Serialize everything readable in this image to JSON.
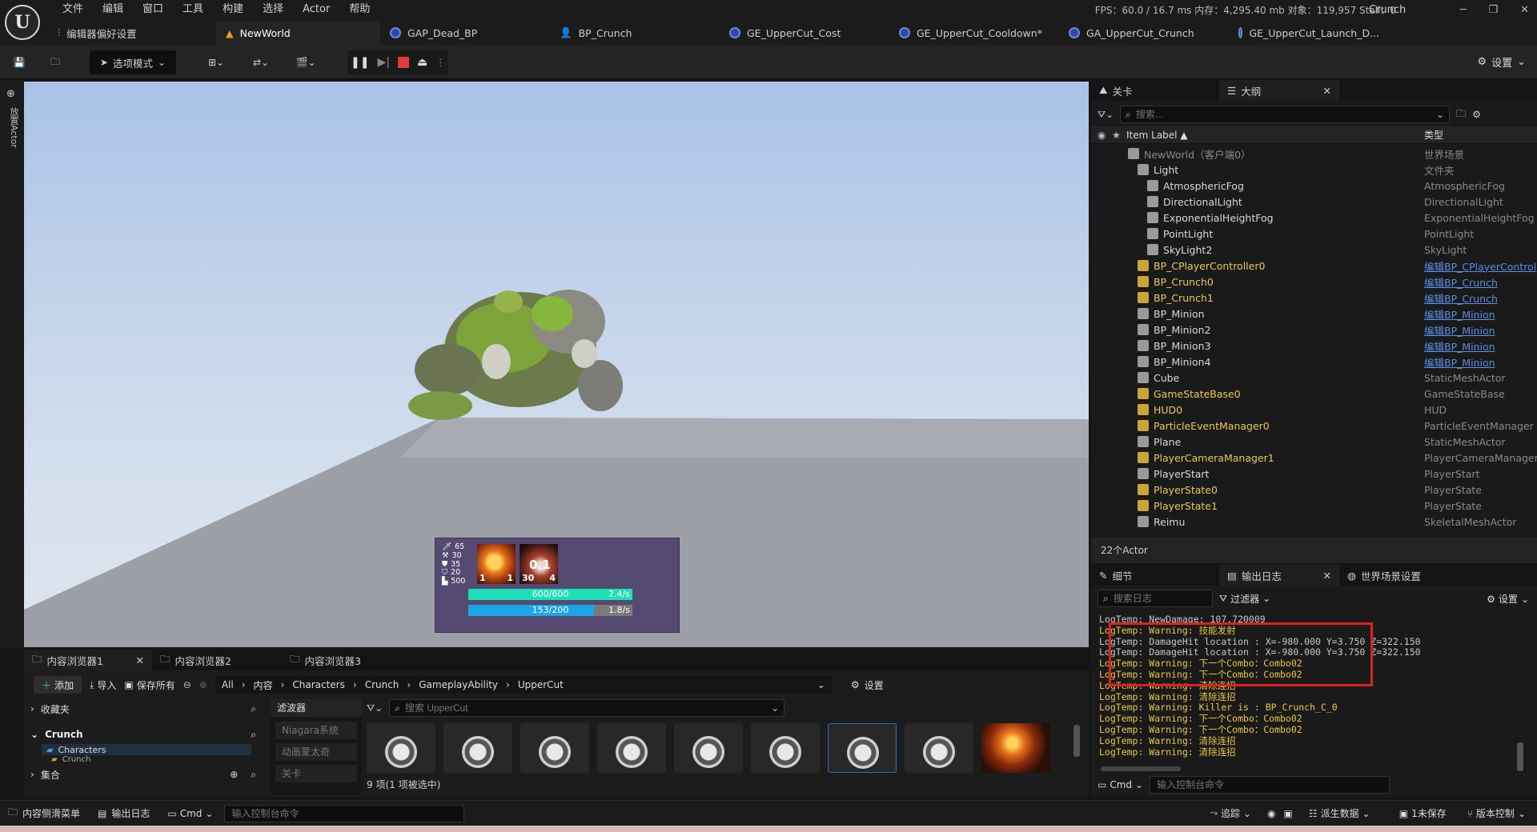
{
  "menu": [
    "文件",
    "编辑",
    "窗口",
    "工具",
    "构建",
    "选择",
    "Actor",
    "帮助"
  ],
  "stats": "FPS：60.0 / 16.7 ms  内存：4,295.40 mb  对象：119,957  Stall：0",
  "project_name": "Crunch",
  "tabs": [
    {
      "label": "编辑器偏好设置"
    },
    {
      "label": "NewWorld"
    },
    {
      "label": "GAP_Dead_BP"
    },
    {
      "label": "BP_Crunch"
    },
    {
      "label": "GE_UpperCut_Cost"
    },
    {
      "label": "GE_UpperCut_Cooldown*"
    },
    {
      "label": "GA_UpperCut_Crunch"
    },
    {
      "label": "GE_UpperCut_Launch_D..."
    }
  ],
  "toolbar": {
    "mode_label": "选项模式",
    "settings_label": "设置"
  },
  "left_strip_label": "放置Actor",
  "hud": {
    "stats": [
      "65",
      "30",
      "35",
      "20",
      "500"
    ],
    "skill1": {
      "left": "1",
      "right": "1"
    },
    "skill2": {
      "cooldown": "0.1",
      "left": "30",
      "right": "4"
    },
    "health": {
      "text": "600/600",
      "rate": "2.4/s",
      "fraction": 1.0
    },
    "mana": {
      "text": "153/200",
      "rate": "1.8/s",
      "fraction": 0.765
    }
  },
  "outliner": {
    "tab_level": "关卡",
    "tab_outline": "大纲",
    "search_placeholder": "搜索...",
    "col_label": "Item Label ▲",
    "col_type": "类型",
    "rows": [
      {
        "label": "NewWorld（客户端0）",
        "type": "世界场景",
        "indent": 3,
        "dim": true,
        "link": false
      },
      {
        "label": "Light",
        "type": "文件夹",
        "indent": 4,
        "dim": false,
        "link": false
      },
      {
        "label": "AtmosphericFog",
        "type": "AtmosphericFog",
        "indent": 5,
        "dim": false,
        "link": false
      },
      {
        "label": "DirectionalLight",
        "type": "DirectionalLight",
        "indent": 5,
        "dim": false,
        "link": false
      },
      {
        "label": "ExponentialHeightFog",
        "type": "ExponentialHeightFog",
        "indent": 5,
        "dim": false,
        "link": false
      },
      {
        "label": "PointLight",
        "type": "PointLight",
        "indent": 5,
        "dim": false,
        "link": false
      },
      {
        "label": "SkyLight2",
        "type": "SkyLight",
        "indent": 5,
        "dim": false,
        "link": false
      },
      {
        "label": "BP_CPlayerController0",
        "type": "编辑BP_CPlayerControl",
        "indent": 4,
        "dim": false,
        "link": true,
        "yellow": true
      },
      {
        "label": "BP_Crunch0",
        "type": "编辑BP_Crunch",
        "indent": 4,
        "dim": false,
        "link": true,
        "yellow": true
      },
      {
        "label": "BP_Crunch1",
        "type": "编辑BP_Crunch",
        "indent": 4,
        "dim": false,
        "link": true,
        "yellow": true
      },
      {
        "label": "BP_Minion",
        "type": "编辑BP_Minion",
        "indent": 4,
        "dim": false,
        "link": true
      },
      {
        "label": "BP_Minion2",
        "type": "编辑BP_Minion",
        "indent": 4,
        "dim": false,
        "link": true
      },
      {
        "label": "BP_Minion3",
        "type": "编辑BP_Minion",
        "indent": 4,
        "dim": false,
        "link": true
      },
      {
        "label": "BP_Minion4",
        "type": "编辑BP_Minion",
        "indent": 4,
        "dim": false,
        "link": true
      },
      {
        "label": "Cube",
        "type": "StaticMeshActor",
        "indent": 4,
        "dim": false,
        "link": false
      },
      {
        "label": "GameStateBase0",
        "type": "GameStateBase",
        "indent": 4,
        "dim": false,
        "link": false,
        "yellow": true
      },
      {
        "label": "HUD0",
        "type": "HUD",
        "indent": 4,
        "dim": false,
        "link": false,
        "yellow": true
      },
      {
        "label": "ParticleEventManager0",
        "type": "ParticleEventManager",
        "indent": 4,
        "dim": false,
        "link": false,
        "yellow": true
      },
      {
        "label": "Plane",
        "type": "StaticMeshActor",
        "indent": 4,
        "dim": false,
        "link": false
      },
      {
        "label": "PlayerCameraManager1",
        "type": "PlayerCameraManager",
        "indent": 4,
        "dim": false,
        "link": false,
        "yellow": true
      },
      {
        "label": "PlayerStart",
        "type": "PlayerStart",
        "indent": 4,
        "dim": false,
        "link": false
      },
      {
        "label": "PlayerState0",
        "type": "PlayerState",
        "indent": 4,
        "dim": false,
        "link": false,
        "yellow": true
      },
      {
        "label": "PlayerState1",
        "type": "PlayerState",
        "indent": 4,
        "dim": false,
        "link": false,
        "yellow": true
      },
      {
        "label": "Reimu",
        "type": "SkeletalMeshActor",
        "indent": 4,
        "dim": false,
        "link": false
      }
    ],
    "count": "22个Actor"
  },
  "log": {
    "tab_details": "细节",
    "tab_output": "输出日志",
    "tab_world": "世界场景设置",
    "search_placeholder": "搜索日志",
    "filter_label": "过滤器",
    "settings_label": "设置",
    "cmd_label": "Cmd",
    "cmd_placeholder": "输入控制台命令",
    "lines": [
      {
        "text": "LogTemp: NewDamage: 107.720009",
        "warn": false
      },
      {
        "text": "LogTemp: Warning: 技能发射",
        "warn": true
      },
      {
        "text": "LogTemp: DamageHit location : X=-980.000 Y=3.750 Z=322.150",
        "warn": false
      },
      {
        "text": "LogTemp: DamageHit location : X=-980.000 Y=3.750 Z=322.150",
        "warn": false
      },
      {
        "text": "LogTemp: Warning: 下一个Combo：Combo02",
        "warn": true
      },
      {
        "text": "LogTemp: Warning: 下一个Combo：Combo02",
        "warn": true
      },
      {
        "text": "LogTemp: Warning: 清除连招",
        "warn": true
      },
      {
        "text": "LogTemp: Warning: 清除连招",
        "warn": true
      },
      {
        "text": "LogTemp: Warning: Killer is : BP_Crunch_C_0",
        "warn": true
      },
      {
        "text": "LogTemp: Warning: 下一个Combo：Combo02",
        "warn": true
      },
      {
        "text": "LogTemp: Warning: 下一个Combo：Combo02",
        "warn": true
      },
      {
        "text": "LogTemp: Warning: 清除连招",
        "warn": true
      },
      {
        "text": "LogTemp: Warning: 清除连招",
        "warn": true
      }
    ]
  },
  "content": {
    "tabs": [
      "内容浏览器1",
      "内容浏览器2",
      "内容浏览器3"
    ],
    "add_label": "添加",
    "import_label": "导入",
    "save_all_label": "保存所有",
    "path": [
      "All",
      "内容",
      "Characters",
      "Crunch",
      "GameplayAbility",
      "UpperCut"
    ],
    "settings_label": "设置",
    "favorites": "收藏夹",
    "crunch": "Crunch",
    "characters": "Characters",
    "crunch_sub": "Crunch",
    "collections": "集合",
    "filters_label": "滤波器",
    "filters": [
      "Niagara系统",
      "动画蒙太奇",
      "关卡"
    ],
    "search_placeholder": "搜索 UpperCut",
    "item_count": "9 项(1 项被选中)"
  },
  "statusbar": {
    "drawer": "内容侧滑菜单",
    "output_log": "输出日志",
    "cmd": "Cmd",
    "cmd_placeholder": "输入控制台命令",
    "trace": "追踪",
    "derived": "派生数据",
    "unsaved": "1未保存",
    "source": "版本控制"
  }
}
